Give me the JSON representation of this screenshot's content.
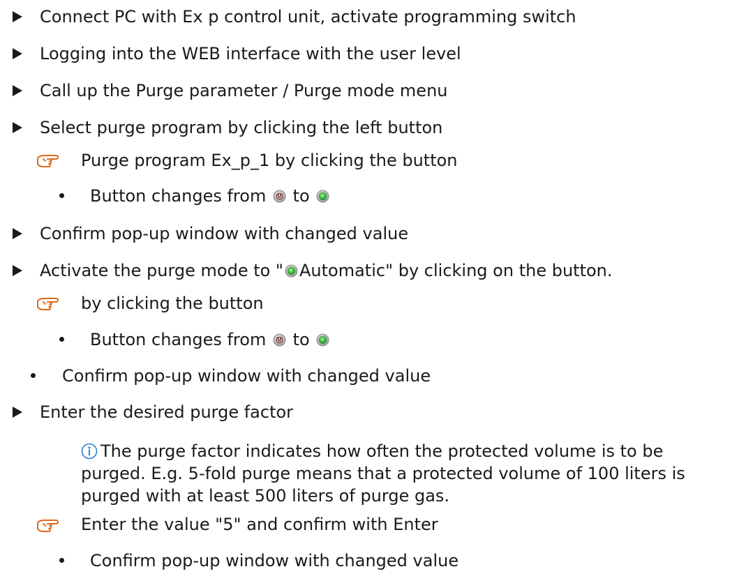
{
  "steps": {
    "s1": "Connect PC with Ex p control unit, activate programming switch",
    "s2": "Logging into the WEB interface with the user level",
    "s3": "Call up the Purge parameter / Purge mode menu",
    "s4": "Select purge program by clicking the left button",
    "h1": "Purge program Ex_p_1 by clicking the button",
    "b1_before": "Button changes from",
    "b1_mid": "to",
    "s5": "Confirm pop-up window with changed value",
    "s6_before": "Activate the purge mode to \"",
    "s6_after": "Automatic\" by clicking on the button.",
    "h2": "by clicking the button",
    "b2_before": "Button changes from",
    "b2_mid": "to",
    "b3": "Confirm pop-up window with changed value",
    "s7": "Enter the desired purge factor",
    "note_l1": "The purge factor indicates how often the protected volume is to be",
    "note_l2": "purged. E.g. 5-fold purge means that a protected volume of 100 liters is",
    "note_l3": "purged with at least 500 liters of purge gas.",
    "h3": "Enter the value \"5\" and confirm with Enter",
    "b4": "Confirm pop-up window with changed value"
  },
  "icons": {
    "step_marker": "right-triangle-icon",
    "hand": "pointing-hand-icon",
    "button_off": "power-button-off-icon",
    "button_on": "green-button-on-icon",
    "info": "info-icon"
  },
  "colors": {
    "hand": "#e06a1b",
    "info": "#2a7fd4",
    "button_on": "#3fb83f"
  }
}
